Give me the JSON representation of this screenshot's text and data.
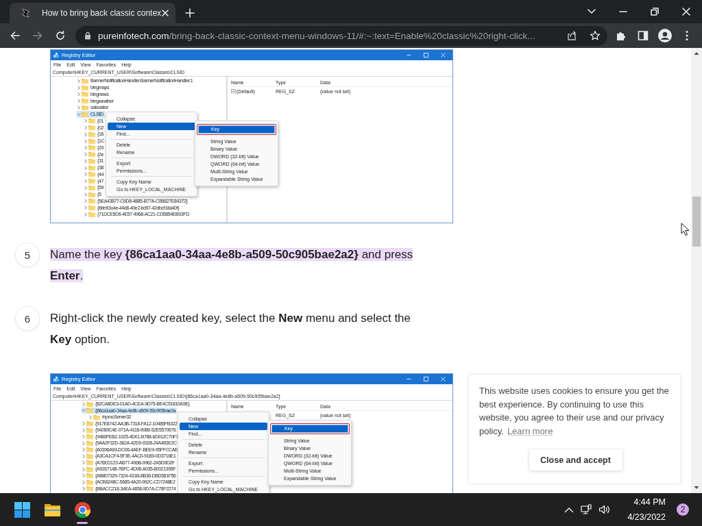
{
  "browser": {
    "tab": {
      "title": "How to bring back classic contex",
      "selected": true
    },
    "url": {
      "host": "pureinfotech.com",
      "path": "/bring-back-classic-context-menu-windows-11/#:~:text=Enable%20classic%20right-click..."
    }
  },
  "article": [
    {
      "kind": "figure",
      "window": {
        "title": "Registry Editor",
        "menu": [
          "File",
          "Edit",
          "View",
          "Favorites",
          "Help"
        ],
        "address": "Computer\\HKEY_CURRENT_USER\\Software\\Classes\\CLSID",
        "tree": [
          {
            "label": "BannerNotificationHandler.BannerNotificationHandler.1",
            "expanded": false,
            "selected": false
          },
          {
            "label": "bingmaps",
            "expanded": false,
            "selected": false
          },
          {
            "label": "bingnews",
            "expanded": false,
            "selected": false
          },
          {
            "label": "bingweather",
            "expanded": false,
            "selected": false
          },
          {
            "label": "calculator",
            "expanded": false,
            "selected": false
          },
          {
            "label": "CLSID",
            "expanded": true,
            "selected": true,
            "children": [
              {
                "label": "{01",
                "expanded": false,
                "selected": false
              },
              {
                "label": "{02",
                "expanded": false,
                "selected": false
              },
              {
                "label": "{16",
                "expanded": false,
                "selected": false
              },
              {
                "label": "{1C",
                "expanded": false,
                "selected": false
              },
              {
                "label": "{20",
                "expanded": false,
                "selected": false
              },
              {
                "label": "{2e",
                "expanded": false,
                "selected": false
              },
              {
                "label": "{31",
                "expanded": false,
                "selected": false
              },
              {
                "label": "{38",
                "expanded": false,
                "selected": false
              },
              {
                "label": "{44",
                "expanded": false,
                "selected": false
              },
              {
                "label": "{47",
                "expanded": false,
                "selected": false
              },
              {
                "label": "{59",
                "expanded": false,
                "selected": false
              },
              {
                "label": "{5",
                "expanded": false,
                "selected": false
              },
              {
                "label": "{5EA43877-C6D8-4885-B77A-C0B827E84372}",
                "expanded": false,
                "selected": false
              },
              {
                "label": "{6bb93o4e-44d8-40e2-bd97-42dbcf18a40f}",
                "expanded": false,
                "selected": false
              },
              {
                "label": "{71DCE5D6-4E57-4968-AC21-CD5854EB93FD",
                "expanded": false,
                "selected": false
              }
            ]
          }
        ],
        "columns": [
          "Name",
          "Type",
          "Data"
        ],
        "values": [
          {
            "name": "(Default)",
            "type": "REG_SZ",
            "data": "(value not set)"
          }
        ],
        "context_menu": [
          {
            "kind": "item",
            "label": "Collapse",
            "selected": false
          },
          {
            "kind": "item",
            "label": "New",
            "selected": true
          },
          {
            "kind": "item",
            "label": "Find...",
            "selected": false
          },
          {
            "kind": "separator"
          },
          {
            "kind": "item",
            "label": "Delete",
            "selected": false
          },
          {
            "kind": "item",
            "label": "Rename",
            "selected": false
          },
          {
            "kind": "separator"
          },
          {
            "kind": "item",
            "label": "Export",
            "selected": false
          },
          {
            "kind": "item",
            "label": "Permissions...",
            "selected": false
          },
          {
            "kind": "separator"
          },
          {
            "kind": "item",
            "label": "Copy Key Name",
            "selected": false
          },
          {
            "kind": "item",
            "label": "Go to HKEY_LOCAL_MACHINE",
            "selected": false
          }
        ],
        "submenu": [
          {
            "label": "Key",
            "selected": true
          },
          {
            "label": "String Value",
            "selected": false
          },
          {
            "label": "Binary Value",
            "selected": false
          },
          {
            "label": "DWORD (32-bit) Value",
            "selected": false
          },
          {
            "label": "QWORD (64-bit) Value",
            "selected": false
          },
          {
            "label": "Multi-String Value",
            "selected": false
          },
          {
            "label": "Expandable String Value",
            "selected": false
          }
        ]
      }
    },
    {
      "kind": "step",
      "number": "5",
      "text": "Name the key **{86ca1aa0-34aa-4e8b-a509-50c905bae2a2}** and press **Enter**.",
      "highlighted": true
    },
    {
      "kind": "step",
      "number": "6",
      "text": "Right-click the newly created key, select the **New** menu and select the **Key** option.",
      "highlighted": false
    },
    {
      "kind": "figure",
      "window": {
        "title": "Registry Editor",
        "menu": [
          "File",
          "Edit",
          "View",
          "Favorites",
          "Help"
        ],
        "address": "Computer\\HKEY_CURRENT_USER\\Software\\Classes\\CLSID\\{86ca1aa0-34aa-4e8b-a509-50c905bae2a2}",
        "tree": [
          {
            "label": "{82CA8DE3-01AD-4CEA-9D75-BE4C51810A9E}",
            "expanded": false,
            "selected": false
          },
          {
            "label": "{86ca1aa0-34aa-4e8b-a509-50c905bae2a",
            "expanded": true,
            "selected": true,
            "children": [
              {
                "label": "InprocServer32",
                "expanded": false,
                "selected": false
              }
            ]
          },
          {
            "label": "{917E8742-AA3B-7318-FA12-10485FB322",
            "expanded": false,
            "selected": false
          },
          {
            "label": "{94269C4E-071A-4116-9086-52E5570676",
            "expanded": false,
            "selected": false
          },
          {
            "label": "{9480FEB2-1025-4D01-B788-6D012C70F7",
            "expanded": false,
            "selected": false
          },
          {
            "label": "{9AA2F32D-362A-42D9-9328-24A483E2C",
            "expanded": false,
            "selected": false
          },
          {
            "label": "{A0396A93-DC06-4AEF-BEE9-95FFCCAE",
            "expanded": false,
            "selected": false
          },
          {
            "label": "{A3CA1CF4-5F3E-4AC0-91B9-0D3716E1",
            "expanded": false,
            "selected": false
          },
          {
            "label": "{A76ED123-AB77-406B-9962-2A5D0D2F",
            "expanded": false,
            "selected": false
          },
          {
            "label": "{A926714B-7BFC-4D08-A035-80021395F",
            "expanded": false,
            "selected": false
          },
          {
            "label": "{AB807329-7324-431B-8B36-DBD581F56",
            "expanded": false,
            "selected": false
          },
          {
            "label": "{ACB6248C-5685-4A20-992C-CD7248E2",
            "expanded": false,
            "selected": false
          },
          {
            "label": "{BBACC218-34EA-4656-9D7A-C78F2274",
            "expanded": false,
            "selected": false
          }
        ],
        "columns": [
          "Name",
          "Type",
          "Data"
        ],
        "values": [
          {
            "type": "REG_SZ",
            "data": "(value not set)"
          }
        ],
        "context_menu": [
          {
            "kind": "item",
            "label": "Collapse",
            "selected": false
          },
          {
            "kind": "item",
            "label": "New",
            "selected": true
          },
          {
            "kind": "item",
            "label": "Find...",
            "selected": false
          },
          {
            "kind": "separator"
          },
          {
            "kind": "item",
            "label": "Delete",
            "selected": false
          },
          {
            "kind": "item",
            "label": "Rename",
            "selected": false
          },
          {
            "kind": "separator"
          },
          {
            "kind": "item",
            "label": "Export",
            "selected": false
          },
          {
            "kind": "item",
            "label": "Permissions...",
            "selected": false
          },
          {
            "kind": "separator"
          },
          {
            "kind": "item",
            "label": "Copy Key Name",
            "selected": false
          },
          {
            "kind": "item",
            "label": "Go to HKEY_LOCAL_MACHINE",
            "selected": false
          }
        ],
        "submenu": [
          {
            "label": "Key",
            "selected": true
          },
          {
            "label": "String Value",
            "selected": false
          },
          {
            "label": "Binary Value",
            "selected": false
          },
          {
            "label": "DWORD (32-bit) Value",
            "selected": false
          },
          {
            "label": "QWORD (64-bit) Value",
            "selected": false
          },
          {
            "label": "Multi-String Value",
            "selected": false
          },
          {
            "label": "Expandable String Value",
            "selected": false
          }
        ]
      }
    }
  ],
  "cookie_notice": {
    "text": "This website uses cookies to ensure you get the best experience. By continuing to use this website, you agree to their use and our privacy policy.",
    "link": "Learn more",
    "button": "Close and accept"
  },
  "taskbar": {
    "apps": [
      {
        "kind": "start",
        "selected": false
      },
      {
        "kind": "files",
        "selected": false
      },
      {
        "kind": "browser",
        "selected": true
      }
    ],
    "time": "4:44 PM",
    "date": "4/23/2022",
    "notifications": "2"
  }
}
